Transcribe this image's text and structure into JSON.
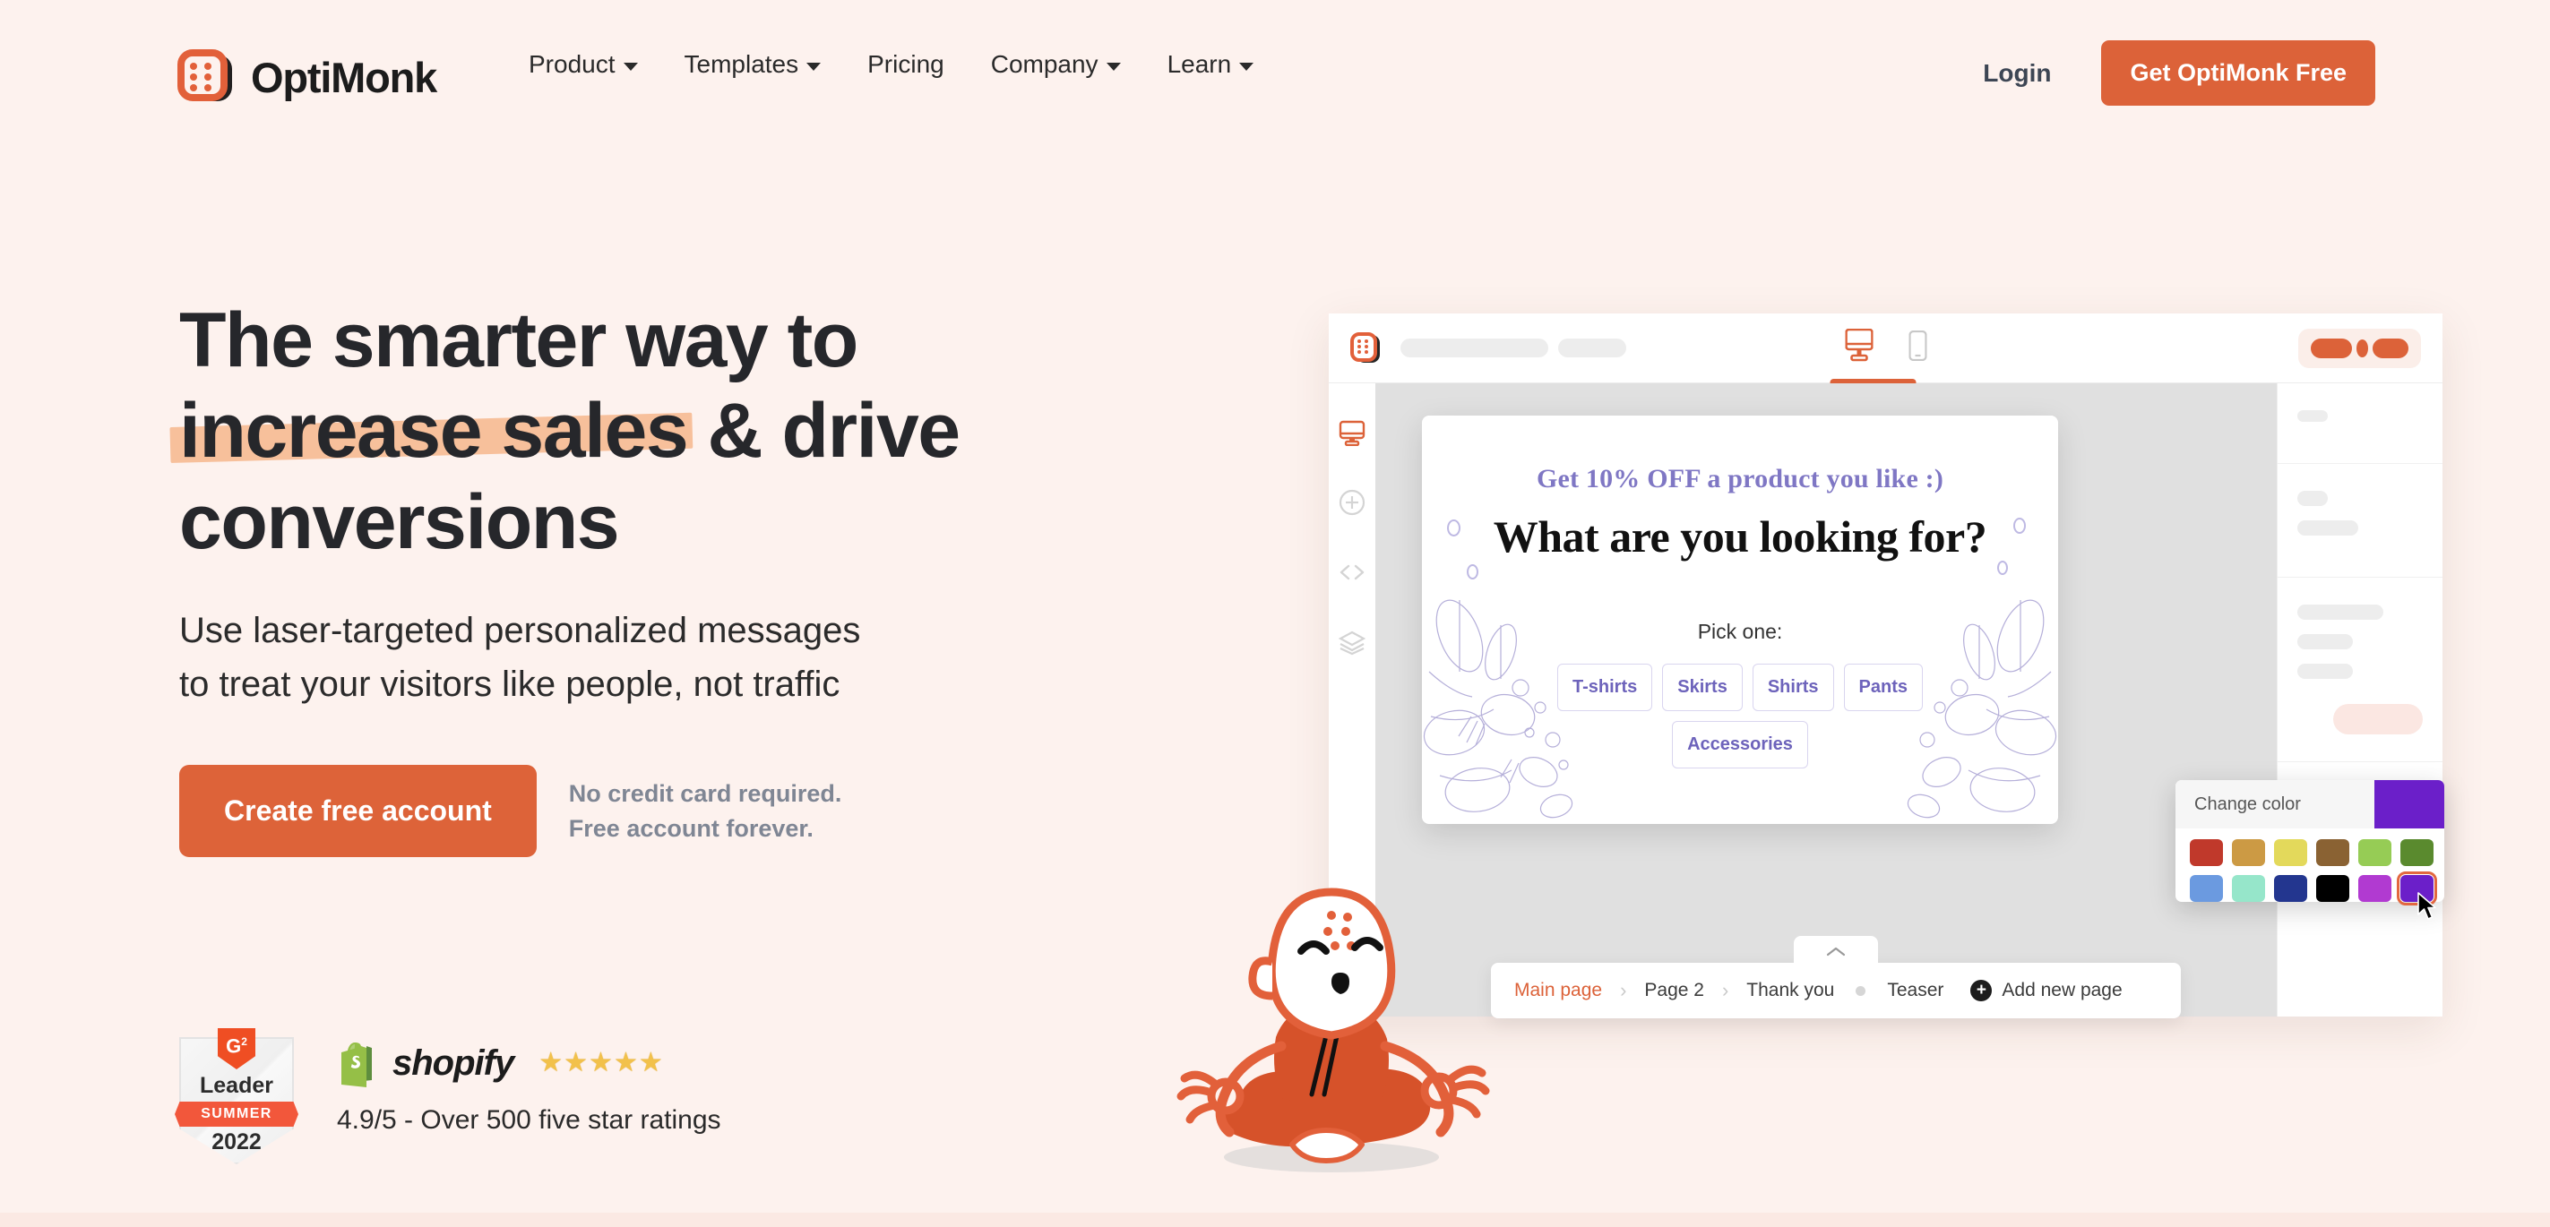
{
  "brand": {
    "name": "OptiMonk",
    "logo_icon": "optimonk-logo-icon"
  },
  "nav": {
    "items": [
      {
        "label": "Product",
        "has_caret": true
      },
      {
        "label": "Templates",
        "has_caret": true
      },
      {
        "label": "Pricing",
        "has_caret": false
      },
      {
        "label": "Company",
        "has_caret": true
      },
      {
        "label": "Learn",
        "has_caret": true
      }
    ],
    "login_label": "Login",
    "cta_label": "Get OptiMonk Free"
  },
  "hero": {
    "headline_line1": "The smarter way to",
    "headline_highlight": "increase sales",
    "headline_line2_rest": " & drive",
    "headline_line3": "conversions",
    "subhead_line1": "Use laser-targeted personalized messages",
    "subhead_line2": "to treat your visitors like people, not traffic",
    "cta_label": "Create free account",
    "note_line1": "No credit card required.",
    "note_line2": "Free account forever.",
    "highlight_color": "#f7bd96",
    "cta_color": "#dd6339"
  },
  "social_proof": {
    "g2": {
      "mark": "G",
      "superscript": "2",
      "title": "Leader",
      "season": "SUMMER",
      "year": "2022"
    },
    "shopify": {
      "name": "shopify",
      "stars": [
        "★",
        "★",
        "★",
        "★",
        "★"
      ],
      "rating_text": "4.9/5 - Over 500 five star ratings"
    }
  },
  "editor": {
    "toolbar": {
      "logo_icon": "optimonk-logo-icon",
      "desktop_icon": "desktop-icon",
      "mobile_icon": "mobile-icon",
      "active_device": "desktop"
    },
    "sidebar_icons": [
      "display-icon",
      "plus-circle-icon",
      "code-icon",
      "layers-icon"
    ],
    "popup": {
      "eyebrow": "Get 10% OFF a product you like :)",
      "title": "What are you looking for?",
      "pick_label": "Pick one:",
      "options_row1": [
        "T-shirts",
        "Skirts",
        "Shirts",
        "Pants"
      ],
      "options_row2": [
        "Accessories"
      ],
      "eyebrow_color": "#7f77c4",
      "option_text_color": "#6d63bb"
    },
    "color_picker": {
      "label": "Change color",
      "current_color": "#6b1fc9",
      "swatches_row1": [
        "#c0392b",
        "#cc9a44",
        "#e3d95b",
        "#8a6233",
        "#96cc55",
        "#5a8a2e"
      ],
      "swatches_row2": [
        "#6b9ae0",
        "#96e6ca",
        "#23368f",
        "#000000",
        "#b13ad1",
        "#6b1fc9"
      ],
      "selected_index": 11
    },
    "pager": {
      "pages": [
        "Main page",
        "Page 2",
        "Thank you"
      ],
      "active_page": "Main page",
      "teaser_label": "Teaser",
      "add_label": "Add new page",
      "separator": "›"
    }
  },
  "mascot": {
    "name": "meditating-monk-mascot"
  }
}
